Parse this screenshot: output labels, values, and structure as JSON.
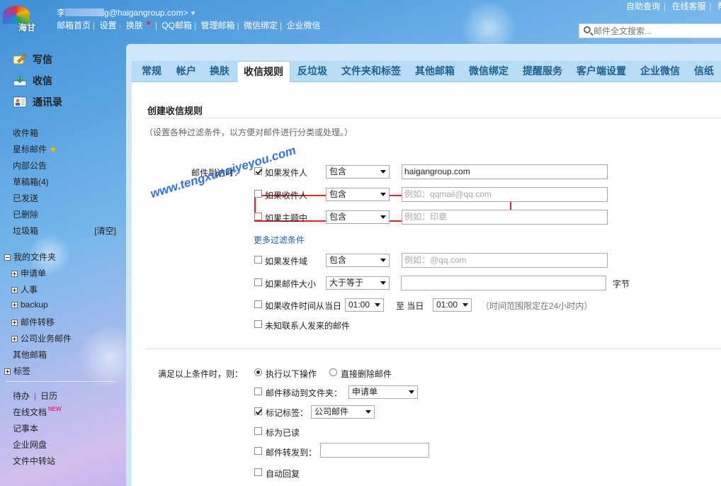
{
  "header": {
    "logo_text": "海甘",
    "user_prefix": "李",
    "user_email_suffix": "g@haigangroup.com>",
    "user_dropdown_glyph": "▼",
    "nav": [
      "邮箱首页",
      "设置",
      "换肤",
      "QQ邮箱",
      "管理邮箱",
      "微信绑定",
      "企业微信"
    ],
    "right_links": [
      "自助查询",
      "在线客服",
      "帮"
    ],
    "search_placeholder": "邮件全文搜索..."
  },
  "sidebar": {
    "compose": "写信",
    "inbox": "收信",
    "contacts": "通讯录",
    "folders": [
      "收件箱",
      "星标邮件",
      "内部公告",
      "草稿箱(4)",
      "已发送",
      "已删除",
      "垃圾箱"
    ],
    "trash_action": "[清空]",
    "my_folders": "我的文件夹",
    "sub_folders": [
      "申请单",
      "人事",
      "backup",
      "邮件转移",
      "公司业务邮件"
    ],
    "other_mailboxes": "其他邮箱",
    "tags": "标签",
    "todo": "待办",
    "calendar": "日历",
    "online_docs": "在线文档",
    "new_badge": "NEW",
    "notes": "记事本",
    "netdisk": "企业网盘",
    "file_transfer": "文件中转站"
  },
  "tabs": [
    "常规",
    "帐户",
    "换肤",
    "收信规则",
    "反垃圾",
    "文件夹和标签",
    "其他邮箱",
    "微信绑定",
    "提醒服务",
    "客户端设置",
    "企业微信",
    "信纸"
  ],
  "active_tab": "收信规则",
  "form": {
    "title": "创建收信规则",
    "description": "（设置各种过滤条件，以方便对邮件进行分类或处理。）",
    "arrival_label": "邮件到达时：",
    "cond_sender": {
      "label": "如果发件人",
      "checked": true,
      "op": "包含",
      "value": "haigangroup.com"
    },
    "cond_recipient": {
      "label": "如果收件人",
      "checked": false,
      "op": "包含",
      "placeholder": "例如：qqmail@qq.com"
    },
    "cond_subject": {
      "label": "如果主题中",
      "checked": false,
      "op": "包含",
      "placeholder": "例如：印章"
    },
    "more_filters": "更多过滤条件",
    "cond_domain": {
      "label": "如果发件域",
      "checked": false,
      "op": "包含",
      "placeholder": "例如：@qq.com"
    },
    "cond_size": {
      "label": "如果邮件大小",
      "checked": false,
      "op": "大于等于",
      "unit": "字节"
    },
    "cond_time": {
      "label": "如果收件时间从当日",
      "checked": false,
      "from": "01:00",
      "to_label": "至 当日",
      "to": "01:00",
      "note": "（时间范围限定在24小时内）"
    },
    "cond_unknown": {
      "label": "未知联系人发来的邮件",
      "checked": false
    },
    "then_label": "满足以上条件时，则：",
    "action_execute": "执行以下操作",
    "action_delete": "直接删除邮件",
    "move_to": {
      "label": "邮件移动到文件夹：",
      "checked": false,
      "value": "申请单"
    },
    "mark_tag": {
      "label": "标记标签：",
      "checked": true,
      "value": "公司邮件"
    },
    "mark_read": {
      "label": "标为已读",
      "checked": false
    },
    "forward": {
      "label": "邮件转发到：",
      "checked": false
    },
    "auto_reply": {
      "label": "自动回复",
      "checked": false
    }
  },
  "watermark": "www.tengxunqiyeyou.com"
}
